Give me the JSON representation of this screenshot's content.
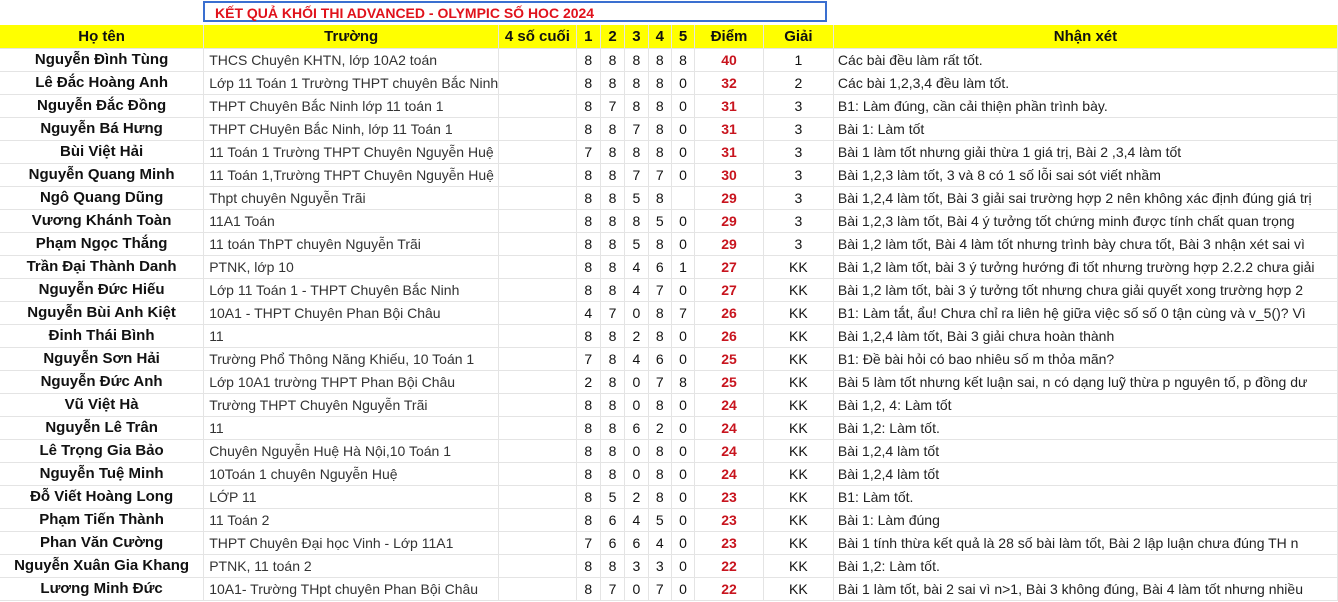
{
  "title": "KẾT QUẢ KHỐI THI ADVANCED - OLYMPIC SỐ HOC 2024",
  "headers": {
    "name": "Họ tên",
    "school": "Trường",
    "last4": "4 số cuối",
    "p1": "1",
    "p2": "2",
    "p3": "3",
    "p4": "4",
    "p5": "5",
    "score": "Điểm",
    "award": "Giải",
    "comment": "Nhận xét"
  },
  "rows": [
    {
      "name": "Nguyễn Đình Tùng",
      "school": "THCS Chuyên KHTN, lớp 10A2 toán",
      "last4": "",
      "p1": "8",
      "p2": "8",
      "p3": "8",
      "p4": "8",
      "p5": "8",
      "score": "40",
      "award": "1",
      "comment": "Các bài đều làm rất tốt."
    },
    {
      "name": "Lê Đắc Hoàng Anh",
      "school": "Lớp 11 Toán 1 Trường THPT chuyên Bắc Ninh",
      "last4": "",
      "p1": "8",
      "p2": "8",
      "p3": "8",
      "p4": "8",
      "p5": "0",
      "score": "32",
      "award": "2",
      "comment": "Các bài 1,2,3,4 đều làm tốt."
    },
    {
      "name": "Nguyễn Đắc Đồng",
      "school": "THPT Chuyên Bắc Ninh lớp 11 toán 1",
      "last4": "",
      "p1": "8",
      "p2": "7",
      "p3": "8",
      "p4": "8",
      "p5": "0",
      "score": "31",
      "award": "3",
      "comment": "B1: Làm đúng, cần cải thiện phần trình bày."
    },
    {
      "name": "Nguyễn Bá Hưng",
      "school": "THPT CHuyên Bắc Ninh, lớp 11 Toán 1",
      "last4": "",
      "p1": "8",
      "p2": "8",
      "p3": "7",
      "p4": "8",
      "p5": "0",
      "score": "31",
      "award": "3",
      "comment": "Bài 1: Làm tốt"
    },
    {
      "name": "Bùi Việt Hải",
      "school": "11 Toán 1 Trường THPT Chuyên Nguyễn Huệ",
      "last4": "",
      "p1": "7",
      "p2": "8",
      "p3": "8",
      "p4": "8",
      "p5": "0",
      "score": "31",
      "award": "3",
      "comment": "Bài 1 làm tốt nhưng giải thừa 1 giá trị, Bài 2 ,3,4 làm tốt"
    },
    {
      "name": "Nguyễn Quang Minh",
      "school": "11 Toán 1,Trường THPT Chuyên Nguyễn Huệ",
      "last4": "",
      "p1": "8",
      "p2": "8",
      "p3": "7",
      "p4": "7",
      "p5": "0",
      "score": "30",
      "award": "3",
      "comment": "Bài 1,2,3 làm tốt, 3 và 8 có 1 số lỗi sai sót viết nhầm"
    },
    {
      "name": "Ngô Quang Dũng",
      "school": "Thpt chuyên Nguyễn Trãi",
      "last4": "",
      "p1": "8",
      "p2": "8",
      "p3": "5",
      "p4": "8",
      "p5": "",
      "score": "29",
      "award": "3",
      "comment": "Bài 1,2,4 làm tốt, Bài 3 giải sai trường hợp 2 nên không xác định đúng giá trị"
    },
    {
      "name": "Vương Khánh Toàn",
      "school": "11A1 Toán",
      "last4": "",
      "p1": "8",
      "p2": "8",
      "p3": "8",
      "p4": "5",
      "p5": "0",
      "score": "29",
      "award": "3",
      "comment": "Bài 1,2,3 làm tốt, Bài 4 ý tưởng tốt chứng minh được tính chất quan trọng"
    },
    {
      "name": "Phạm Ngọc Thắng",
      "school": "11 toán ThPT chuyên Nguyễn Trãi",
      "last4": "",
      "p1": "8",
      "p2": "8",
      "p3": "5",
      "p4": "8",
      "p5": "0",
      "score": "29",
      "award": "3",
      "comment": "Bài 1,2 làm tốt, Bài 4 làm tốt nhưng trình bày chưa tốt, Bài 3 nhận xét sai vì"
    },
    {
      "name": "Trần Đại Thành Danh",
      "school": "PTNK, lớp 10",
      "last4": "",
      "p1": "8",
      "p2": "8",
      "p3": "4",
      "p4": "6",
      "p5": "1",
      "score": "27",
      "award": "KK",
      "comment": "Bài 1,2 làm tốt, bài 3 ý tưởng hướng đi tốt nhưng trường hợp 2.2.2 chưa giải"
    },
    {
      "name": "Nguyễn Đức Hiếu",
      "school": "Lớp 11 Toán 1 - THPT Chuyên Bắc Ninh",
      "last4": "",
      "p1": "8",
      "p2": "8",
      "p3": "4",
      "p4": "7",
      "p5": "0",
      "score": "27",
      "award": "KK",
      "comment": "Bài 1,2 làm tốt, bài 3 ý tưởng tốt nhưng chưa giải quyết xong trường hợp 2"
    },
    {
      "name": "Nguyễn Bùi Anh Kiệt",
      "school": "10A1 - THPT Chuyên Phan Bội Châu",
      "last4": "",
      "p1": "4",
      "p2": "7",
      "p3": "0",
      "p4": "8",
      "p5": "7",
      "score": "26",
      "award": "KK",
      "comment": "B1: Làm tắt, ẩu! Chưa chỉ ra liên hệ giữa việc số số 0 tận cùng và v_5()? Vì"
    },
    {
      "name": "Đinh Thái Bình",
      "school": "11",
      "last4": "",
      "p1": "8",
      "p2": "8",
      "p3": "2",
      "p4": "8",
      "p5": "0",
      "score": "26",
      "award": "KK",
      "comment": "Bài 1,2,4 làm tốt, Bài 3 giải chưa hoàn thành"
    },
    {
      "name": "Nguyễn Sơn Hải",
      "school": "Trường Phổ Thông Năng Khiếu, 10 Toán 1",
      "last4": "",
      "p1": "7",
      "p2": "8",
      "p3": "4",
      "p4": "6",
      "p5": "0",
      "score": "25",
      "award": "KK",
      "comment": "B1: Đề bài hỏi có bao nhiêu số m thỏa mãn?"
    },
    {
      "name": "Nguyễn Đức Anh",
      "school": "Lớp 10A1 trường THPT Phan Bội Châu",
      "last4": "",
      "p1": "2",
      "p2": "8",
      "p3": "0",
      "p4": "7",
      "p5": "8",
      "score": "25",
      "award": "KK",
      "comment": "Bài 5 làm tốt nhưng kết luận sai, n có dạng luỹ thừa p nguyên tố, p đồng dư"
    },
    {
      "name": "Vũ Việt Hà",
      "school": "Trường THPT Chuyên Nguyễn Trãi",
      "last4": "",
      "p1": "8",
      "p2": "8",
      "p3": "0",
      "p4": "8",
      "p5": "0",
      "score": "24",
      "award": "KK",
      "comment": "Bài 1,2, 4: Làm tốt"
    },
    {
      "name": "Nguyễn Lê Trân",
      "school": "11",
      "last4": "",
      "p1": "8",
      "p2": "8",
      "p3": "6",
      "p4": "2",
      "p5": "0",
      "score": "24",
      "award": "KK",
      "comment": "Bài 1,2: Làm tốt."
    },
    {
      "name": "Lê Trọng Gia Bảo",
      "school": "Chuyên Nguyễn Huệ Hà Nội,10 Toán 1",
      "last4": "",
      "p1": "8",
      "p2": "8",
      "p3": "0",
      "p4": "8",
      "p5": "0",
      "score": "24",
      "award": "KK",
      "comment": "Bài 1,2,4 làm tốt"
    },
    {
      "name": "Nguyễn Tuệ Minh",
      "school": "10Toán 1 chuyên Nguyễn Huệ",
      "last4": "",
      "p1": "8",
      "p2": "8",
      "p3": "0",
      "p4": "8",
      "p5": "0",
      "score": "24",
      "award": "KK",
      "comment": "Bài 1,2,4 làm tốt"
    },
    {
      "name": "Đỗ Viết Hoàng Long",
      "school": "LỚP 11",
      "last4": "",
      "p1": "8",
      "p2": "5",
      "p3": "2",
      "p4": "8",
      "p5": "0",
      "score": "23",
      "award": "KK",
      "comment": "B1: Làm tốt."
    },
    {
      "name": "Phạm Tiến Thành",
      "school": "11 Toán 2",
      "last4": "",
      "p1": "8",
      "p2": "6",
      "p3": "4",
      "p4": "5",
      "p5": "0",
      "score": "23",
      "award": "KK",
      "comment": "Bài 1: Làm đúng"
    },
    {
      "name": "Phan Văn Cường",
      "school": "THPT Chuyên Đại học Vinh - Lớp 11A1",
      "last4": "",
      "p1": "7",
      "p2": "6",
      "p3": "6",
      "p4": "4",
      "p5": "0",
      "score": "23",
      "award": "KK",
      "comment": "Bài 1 tính thừa kết quả là 28 số bài làm tốt, Bài 2 lập luận chưa đúng TH n"
    },
    {
      "name": "Nguyễn Xuân Gia Khang",
      "school": "PTNK, 11 toán 2",
      "last4": "",
      "p1": "8",
      "p2": "8",
      "p3": "3",
      "p4": "3",
      "p5": "0",
      "score": "22",
      "award": "KK",
      "comment": "Bài 1,2: Làm tốt."
    },
    {
      "name": "Lương Minh Đức",
      "school": "10A1- Trường THpt chuyên Phan Bội Châu",
      "last4": "",
      "p1": "8",
      "p2": "7",
      "p3": "0",
      "p4": "7",
      "p5": "0",
      "score": "22",
      "award": "KK",
      "comment": "Bài 1 làm tốt, bài 2 sai vì n>1, Bài 3 không đúng, Bài 4 làm tốt nhưng nhiều"
    }
  ]
}
